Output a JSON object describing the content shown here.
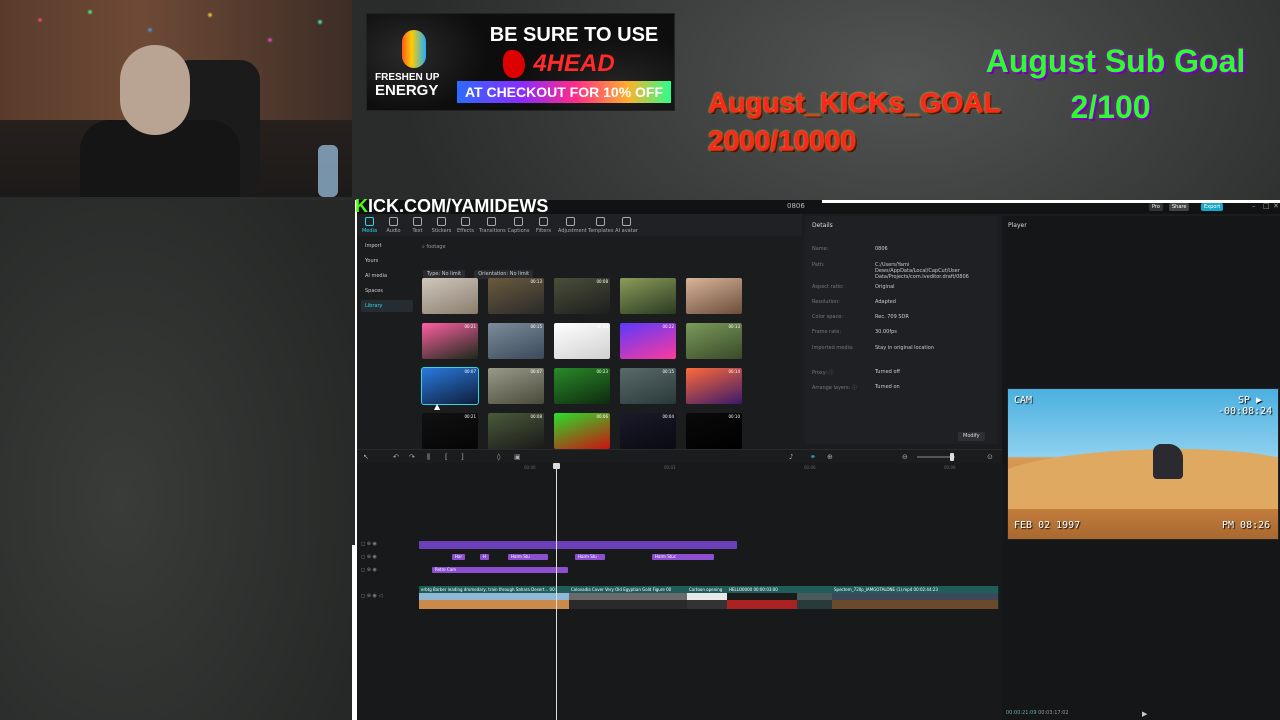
{
  "stream": {
    "kick_prefix": "K",
    "kick_rest": "ICK.COM/YAMIDEWS",
    "ad": {
      "brand_top": "FRESHEN UP",
      "brand_bottom": "ENERGY",
      "line1": "BE SURE TO USE",
      "line2": "4HEAD",
      "line3": "AT CHECKOUT FOR 10% OFF"
    },
    "kicks_goal_title": "August_KICKs_GOAL",
    "kicks_goal_count": "2000/10000",
    "sub_goal_title": "August Sub Goal",
    "sub_goal_count": "2/100",
    "cam_overlay": {
      "label": "CAM",
      "sp": "SP ▶",
      "counter": "-00:08:24",
      "date": "FEB 02 1997",
      "time": "PM 08:26"
    }
  },
  "editor": {
    "project_name": "0806",
    "title_buttons": [
      "Pro",
      "Share",
      "Export"
    ],
    "toolbar": [
      "Media",
      "Audio",
      "Text",
      "Stickers",
      "Effects",
      "Transitions",
      "Captions",
      "Filters",
      "Adjustment",
      "Templates",
      "AI avatar"
    ],
    "sidebar": [
      "Import",
      "Yours",
      "AI media",
      "Spaces",
      "Library"
    ],
    "search_value": "footage",
    "filters": [
      "Type: No limit",
      "Orientation: No limit"
    ],
    "thumbs": [
      {
        "dur": "",
        "c1": "#cfc7bc",
        "c2": "#8a7d6d"
      },
      {
        "dur": "00:13",
        "c1": "#6b5a3e",
        "c2": "#2a2a2a"
      },
      {
        "dur": "00:08",
        "c1": "#4b4f3a",
        "c2": "#1e1e1e"
      },
      {
        "dur": "",
        "c1": "#8a9c5a",
        "c2": "#2b3a22"
      },
      {
        "dur": "",
        "c1": "#d8b49a",
        "c2": "#6b4e3a"
      },
      {
        "dur": "00:21",
        "c1": "#ff5fa2",
        "c2": "#1a2a1a"
      },
      {
        "dur": "00:15",
        "c1": "#7c8c9a",
        "c2": "#3a4a5a"
      },
      {
        "dur": "00:08",
        "c1": "#ffffff",
        "c2": "#d0d0d0"
      },
      {
        "dur": "00:22",
        "c1": "#5a3aff",
        "c2": "#ff3a9a"
      },
      {
        "dur": "00:13",
        "c1": "#7a9a5a",
        "c2": "#3a4a2a"
      },
      {
        "dur": "00:07",
        "c1": "#2a7adf",
        "c2": "#0e1e3a"
      },
      {
        "dur": "00:07",
        "c1": "#9a9a8a",
        "c2": "#4a4a3a"
      },
      {
        "dur": "00:23",
        "c1": "#2a8a2a",
        "c2": "#0e2a0e"
      },
      {
        "dur": "00:15",
        "c1": "#5a6a6a",
        "c2": "#2a3a3a"
      },
      {
        "dur": "00:14",
        "c1": "#ff6a3a",
        "c2": "#3a1a6a"
      },
      {
        "dur": "00:21",
        "c1": "#111111",
        "c2": "#050505"
      },
      {
        "dur": "00:08",
        "c1": "#4a5a3a",
        "c2": "#1a1a1a"
      },
      {
        "dur": "00:06",
        "c1": "#2adf2a",
        "c2": "#cc1111"
      },
      {
        "dur": "00:04",
        "c1": "#1a1a2a",
        "c2": "#0a0a12"
      },
      {
        "dur": "00:10",
        "c1": "#0a0a0a",
        "c2": "#000000"
      }
    ],
    "details": {
      "title": "Details",
      "rows": [
        {
          "k": "Name:",
          "v": "0806"
        },
        {
          "k": "Path:",
          "v": "C:/Users/Yami Dews/AppData/Local/CapCut/User Data/Projects/com.lveditor.draft/0806"
        },
        {
          "k": "Aspect ratio:",
          "v": "Original"
        },
        {
          "k": "Resolution:",
          "v": "Adapted"
        },
        {
          "k": "Color space:",
          "v": "Rec. 709 SDR"
        },
        {
          "k": "Frame rate:",
          "v": "30.00fps"
        },
        {
          "k": "Imported media:",
          "v": "Stay in original location"
        },
        {
          "k": "Proxy: ⓘ",
          "v": "Turned off"
        },
        {
          "k": "Arrange layers: ⓘ",
          "v": "Turned on"
        }
      ],
      "modify": "Modify"
    },
    "player": {
      "title": "Player",
      "current": "00:00:21:09",
      "total": "00:03:17:02"
    },
    "ruler": [
      "00:00",
      "00:03",
      "00:06",
      "00:09"
    ],
    "text_clips": [
      "Har",
      "H",
      "Harm Stu",
      "Harm Stu",
      "Harm Stuc"
    ],
    "retro_clip": "Retro Cam",
    "video_clips": [
      {
        "label": "erbtg  Barber leading dromedary, train through Sahara Desert...  00:",
        "c1": "#8fb7d6",
        "c2": "#c98a4a"
      },
      {
        "label": "Colovadia Cover Very Old Egyptian Gold Figure  00",
        "c1": "#6a6a6a",
        "c2": "#2a2a2a"
      },
      {
        "label": "Cartoon opening",
        "c1": "#e8e8e8",
        "c2": "#333333"
      },
      {
        "label": "HELLO0000 00:00:03:00",
        "c1": "#1a1a1a",
        "c2": "#aa2222"
      },
      {
        "label": "",
        "c1": "#4a5a5a",
        "c2": "#2a3a3a"
      },
      {
        "label": "Spectem_720p_IAMGOTALONE (1).mp4  00:02:44:23",
        "c1": "#3a4a5a",
        "c2": "#6a4a2a"
      }
    ]
  }
}
